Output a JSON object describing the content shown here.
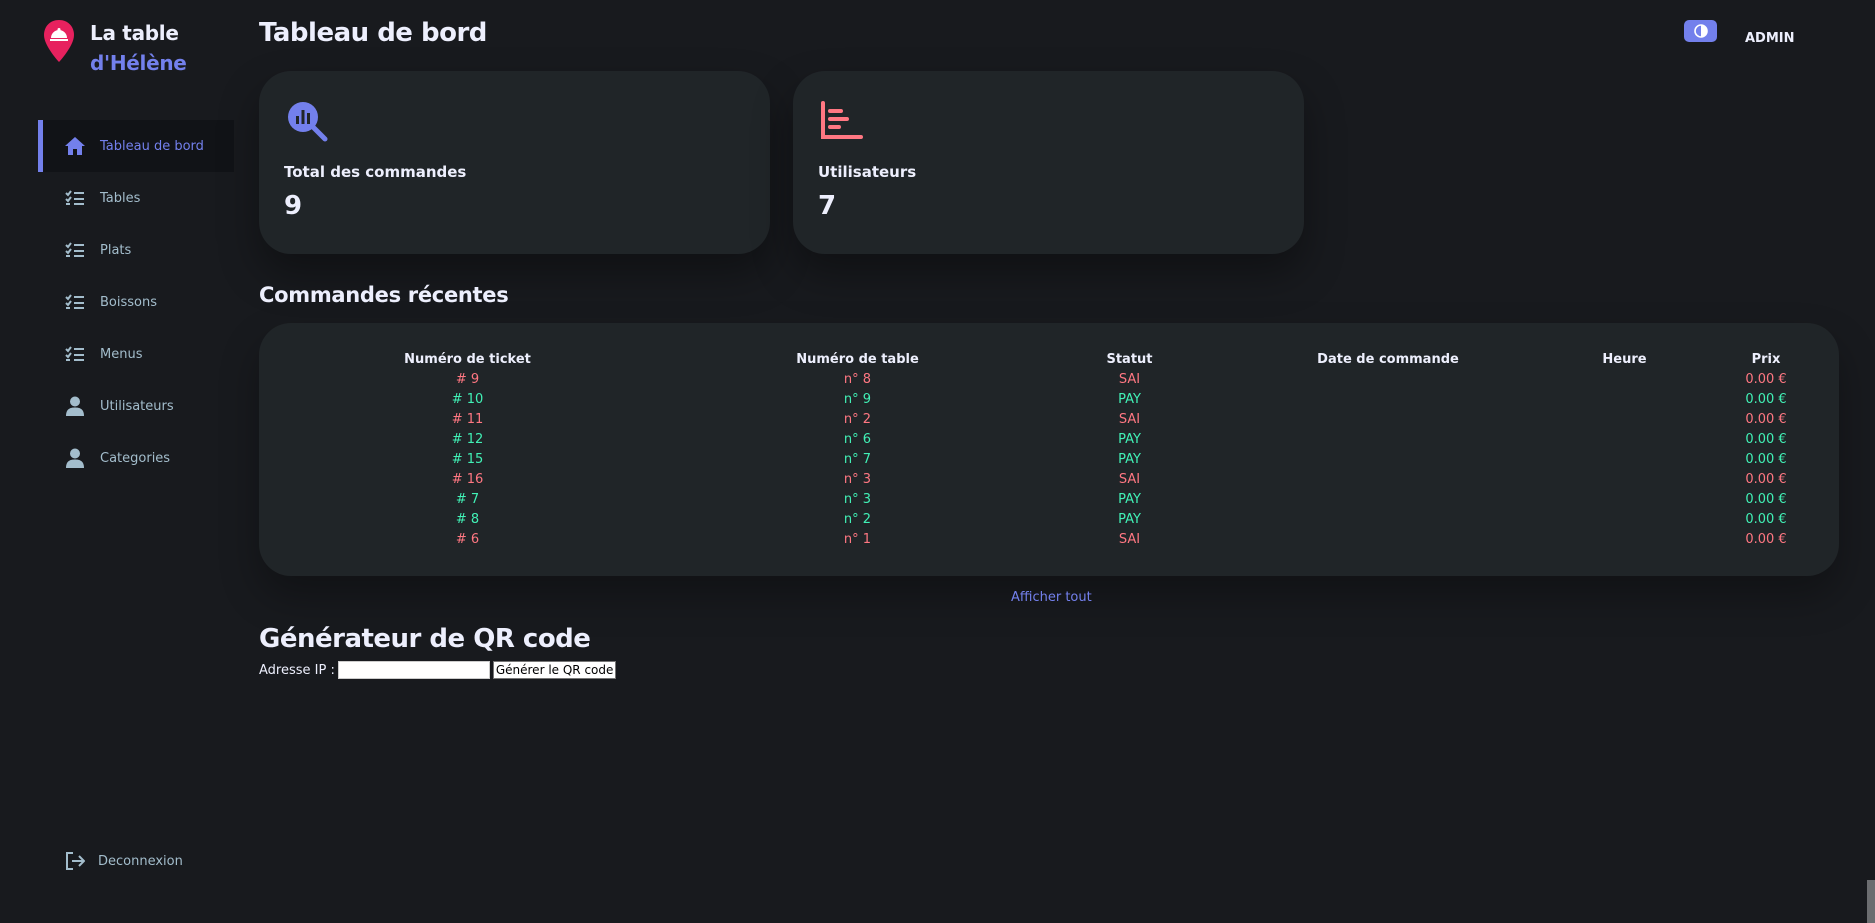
{
  "brand": {
    "line1": "La table",
    "line2": "d'Hélène",
    "logo_icon": "restaurant-pin-icon",
    "pin_color": "#e7215e"
  },
  "colors": {
    "background": "#181a1e",
    "card": "#202528",
    "primary": "#7380ec",
    "danger": "#ff7782",
    "success": "#41f1b6",
    "muted": "#a3bdcc"
  },
  "sidebar": {
    "items": [
      {
        "label": "Tableau de bord",
        "icon": "home-icon",
        "active": true
      },
      {
        "label": "Tables",
        "icon": "checklist-icon",
        "active": false
      },
      {
        "label": "Plats",
        "icon": "checklist-icon",
        "active": false
      },
      {
        "label": "Boissons",
        "icon": "checklist-icon",
        "active": false
      },
      {
        "label": "Menus",
        "icon": "checklist-icon",
        "active": false
      },
      {
        "label": "Utilisateurs",
        "icon": "person-icon",
        "active": false
      },
      {
        "label": "Categories",
        "icon": "person-icon",
        "active": false
      }
    ],
    "logout": {
      "label": "Deconnexion",
      "icon": "logout-icon"
    }
  },
  "topbar": {
    "theme_toggle_icon": "contrast-icon",
    "user": "ADMIN"
  },
  "page": {
    "title": "Tableau de bord"
  },
  "cards": [
    {
      "label": "Total des commandes",
      "value": "9",
      "icon": "search-chart-icon",
      "icon_color": "#7380ec"
    },
    {
      "label": "Utilisateurs",
      "value": "7",
      "icon": "bar-chart-icon",
      "icon_color": "#ff7782"
    }
  ],
  "orders": {
    "title": "Commandes récentes",
    "columns": [
      "Numéro de ticket",
      "Numéro de table",
      "Statut",
      "Date de commande",
      "Heure",
      "Prix"
    ],
    "rows": [
      {
        "ticket": "# 9",
        "table": "n° 8",
        "status": "SAI",
        "date": "",
        "time": "",
        "price": "0.00 €"
      },
      {
        "ticket": "# 10",
        "table": "n° 9",
        "status": "PAY",
        "date": "",
        "time": "",
        "price": "0.00 €"
      },
      {
        "ticket": "# 11",
        "table": "n° 2",
        "status": "SAI",
        "date": "",
        "time": "",
        "price": "0.00 €"
      },
      {
        "ticket": "# 12",
        "table": "n° 6",
        "status": "PAY",
        "date": "",
        "time": "",
        "price": "0.00 €"
      },
      {
        "ticket": "# 15",
        "table": "n° 7",
        "status": "PAY",
        "date": "",
        "time": "",
        "price": "0.00 €"
      },
      {
        "ticket": "# 16",
        "table": "n° 3",
        "status": "SAI",
        "date": "",
        "time": "",
        "price": "0.00 €"
      },
      {
        "ticket": "# 7",
        "table": "n° 3",
        "status": "PAY",
        "date": "",
        "time": "",
        "price": "0.00 €"
      },
      {
        "ticket": "# 8",
        "table": "n° 2",
        "status": "PAY",
        "date": "",
        "time": "",
        "price": "0.00 €"
      },
      {
        "ticket": "# 6",
        "table": "n° 1",
        "status": "SAI",
        "date": "",
        "time": "",
        "price": "0.00 €"
      }
    ],
    "show_all": "Afficher tout"
  },
  "qr": {
    "title": "Générateur de QR code",
    "ip_label": "Adresse IP :",
    "ip_value": "",
    "button": "Générer le QR code"
  }
}
